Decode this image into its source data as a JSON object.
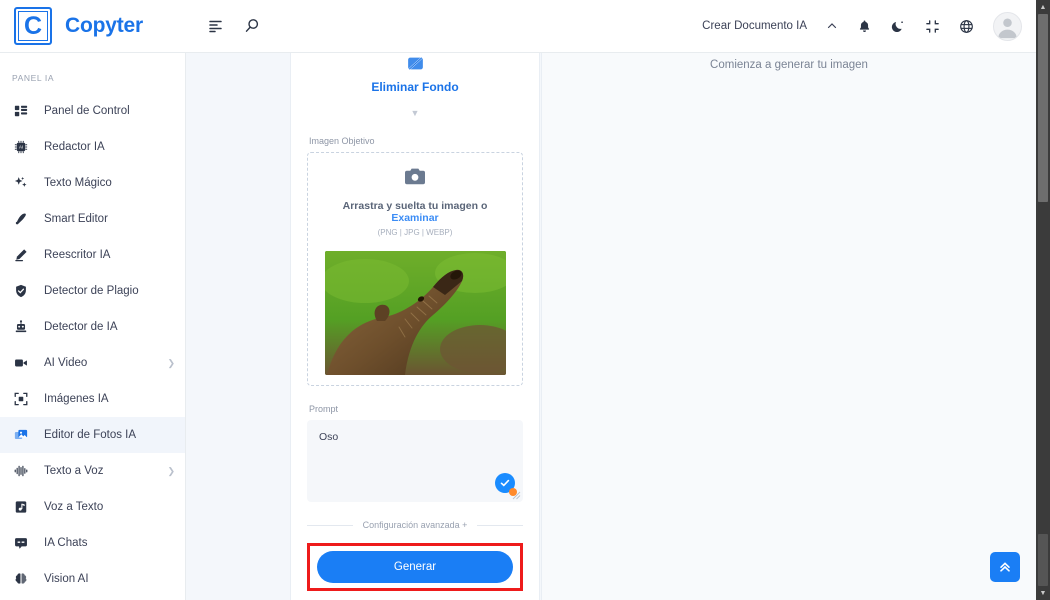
{
  "header": {
    "brand_letter": "C",
    "brand_name": "Copyter",
    "menu_icon": "menu-align-icon",
    "search_icon": "search-icon",
    "create_doc_label": "Crear Documento IA",
    "chevron_icon": "chevron-up-icon",
    "bell_icon": "bell-icon",
    "theme_icon": "moon-icon",
    "fullscreen_icon": "compress-icon",
    "language_icon": "globe-icon",
    "avatar_icon": "user-avatar-icon"
  },
  "sidebar": {
    "section_label": "PANEL IA",
    "items": [
      {
        "label": "Panel de Control",
        "icon": "dashboard-icon",
        "active": false,
        "chevron": false
      },
      {
        "label": "Redactor IA",
        "icon": "chip-ai-icon",
        "active": false,
        "chevron": false
      },
      {
        "label": "Texto Mágico",
        "icon": "sparkles-icon",
        "active": false,
        "chevron": false
      },
      {
        "label": "Smart Editor",
        "icon": "pen-icon",
        "active": false,
        "chevron": false
      },
      {
        "label": "Reescritor IA",
        "icon": "pencil-icon",
        "active": false,
        "chevron": false
      },
      {
        "label": "Detector de Plagio",
        "icon": "shield-icon",
        "active": false,
        "chevron": false
      },
      {
        "label": "Detector de IA",
        "icon": "robot-icon",
        "active": false,
        "chevron": false
      },
      {
        "label": "AI Video",
        "icon": "video-camera-icon",
        "active": false,
        "chevron": true
      },
      {
        "label": "Imágenes IA",
        "icon": "image-frame-icon",
        "active": false,
        "chevron": false
      },
      {
        "label": "Editor de Fotos IA",
        "icon": "photo-edit-icon",
        "active": true,
        "chevron": false
      },
      {
        "label": "Texto a Voz",
        "icon": "waveform-icon",
        "active": false,
        "chevron": true
      },
      {
        "label": "Voz a Texto",
        "icon": "audio-file-icon",
        "active": false,
        "chevron": false
      },
      {
        "label": "IA Chats",
        "icon": "chat-icon",
        "active": false,
        "chevron": false
      },
      {
        "label": "Vision AI",
        "icon": "brain-icon",
        "active": false,
        "chevron": false
      }
    ]
  },
  "tool": {
    "icon": "image-slash-icon",
    "name": "Eliminar Fondo",
    "caret_icon": "chevron-down-icon"
  },
  "form": {
    "image_label": "Imagen Objetivo",
    "dropzone": {
      "icon": "camera-icon",
      "text_before": "Arrastra y suelta tu imagen o ",
      "browse_link": "Examinar",
      "formats": "(PNG | JPG | WEBP)"
    },
    "preview_alt": "bear-photo",
    "prompt_label": "Prompt",
    "prompt_value": "Oso",
    "prompt_placeholder": "Prompt",
    "grammar_badge_icon": "check-circle-icon",
    "advanced_label": "Configuración avanzada +",
    "generate_label": "Generar"
  },
  "result": {
    "empty_text": "Comienza a generar tu imagen"
  },
  "fab": {
    "icon": "double-chevron-up-icon"
  },
  "colors": {
    "brand_blue": "#1a73e8",
    "button_blue": "#1a7ef5",
    "highlight_red": "#ee1b1b",
    "workspace_bg": "#f4f7fb"
  }
}
